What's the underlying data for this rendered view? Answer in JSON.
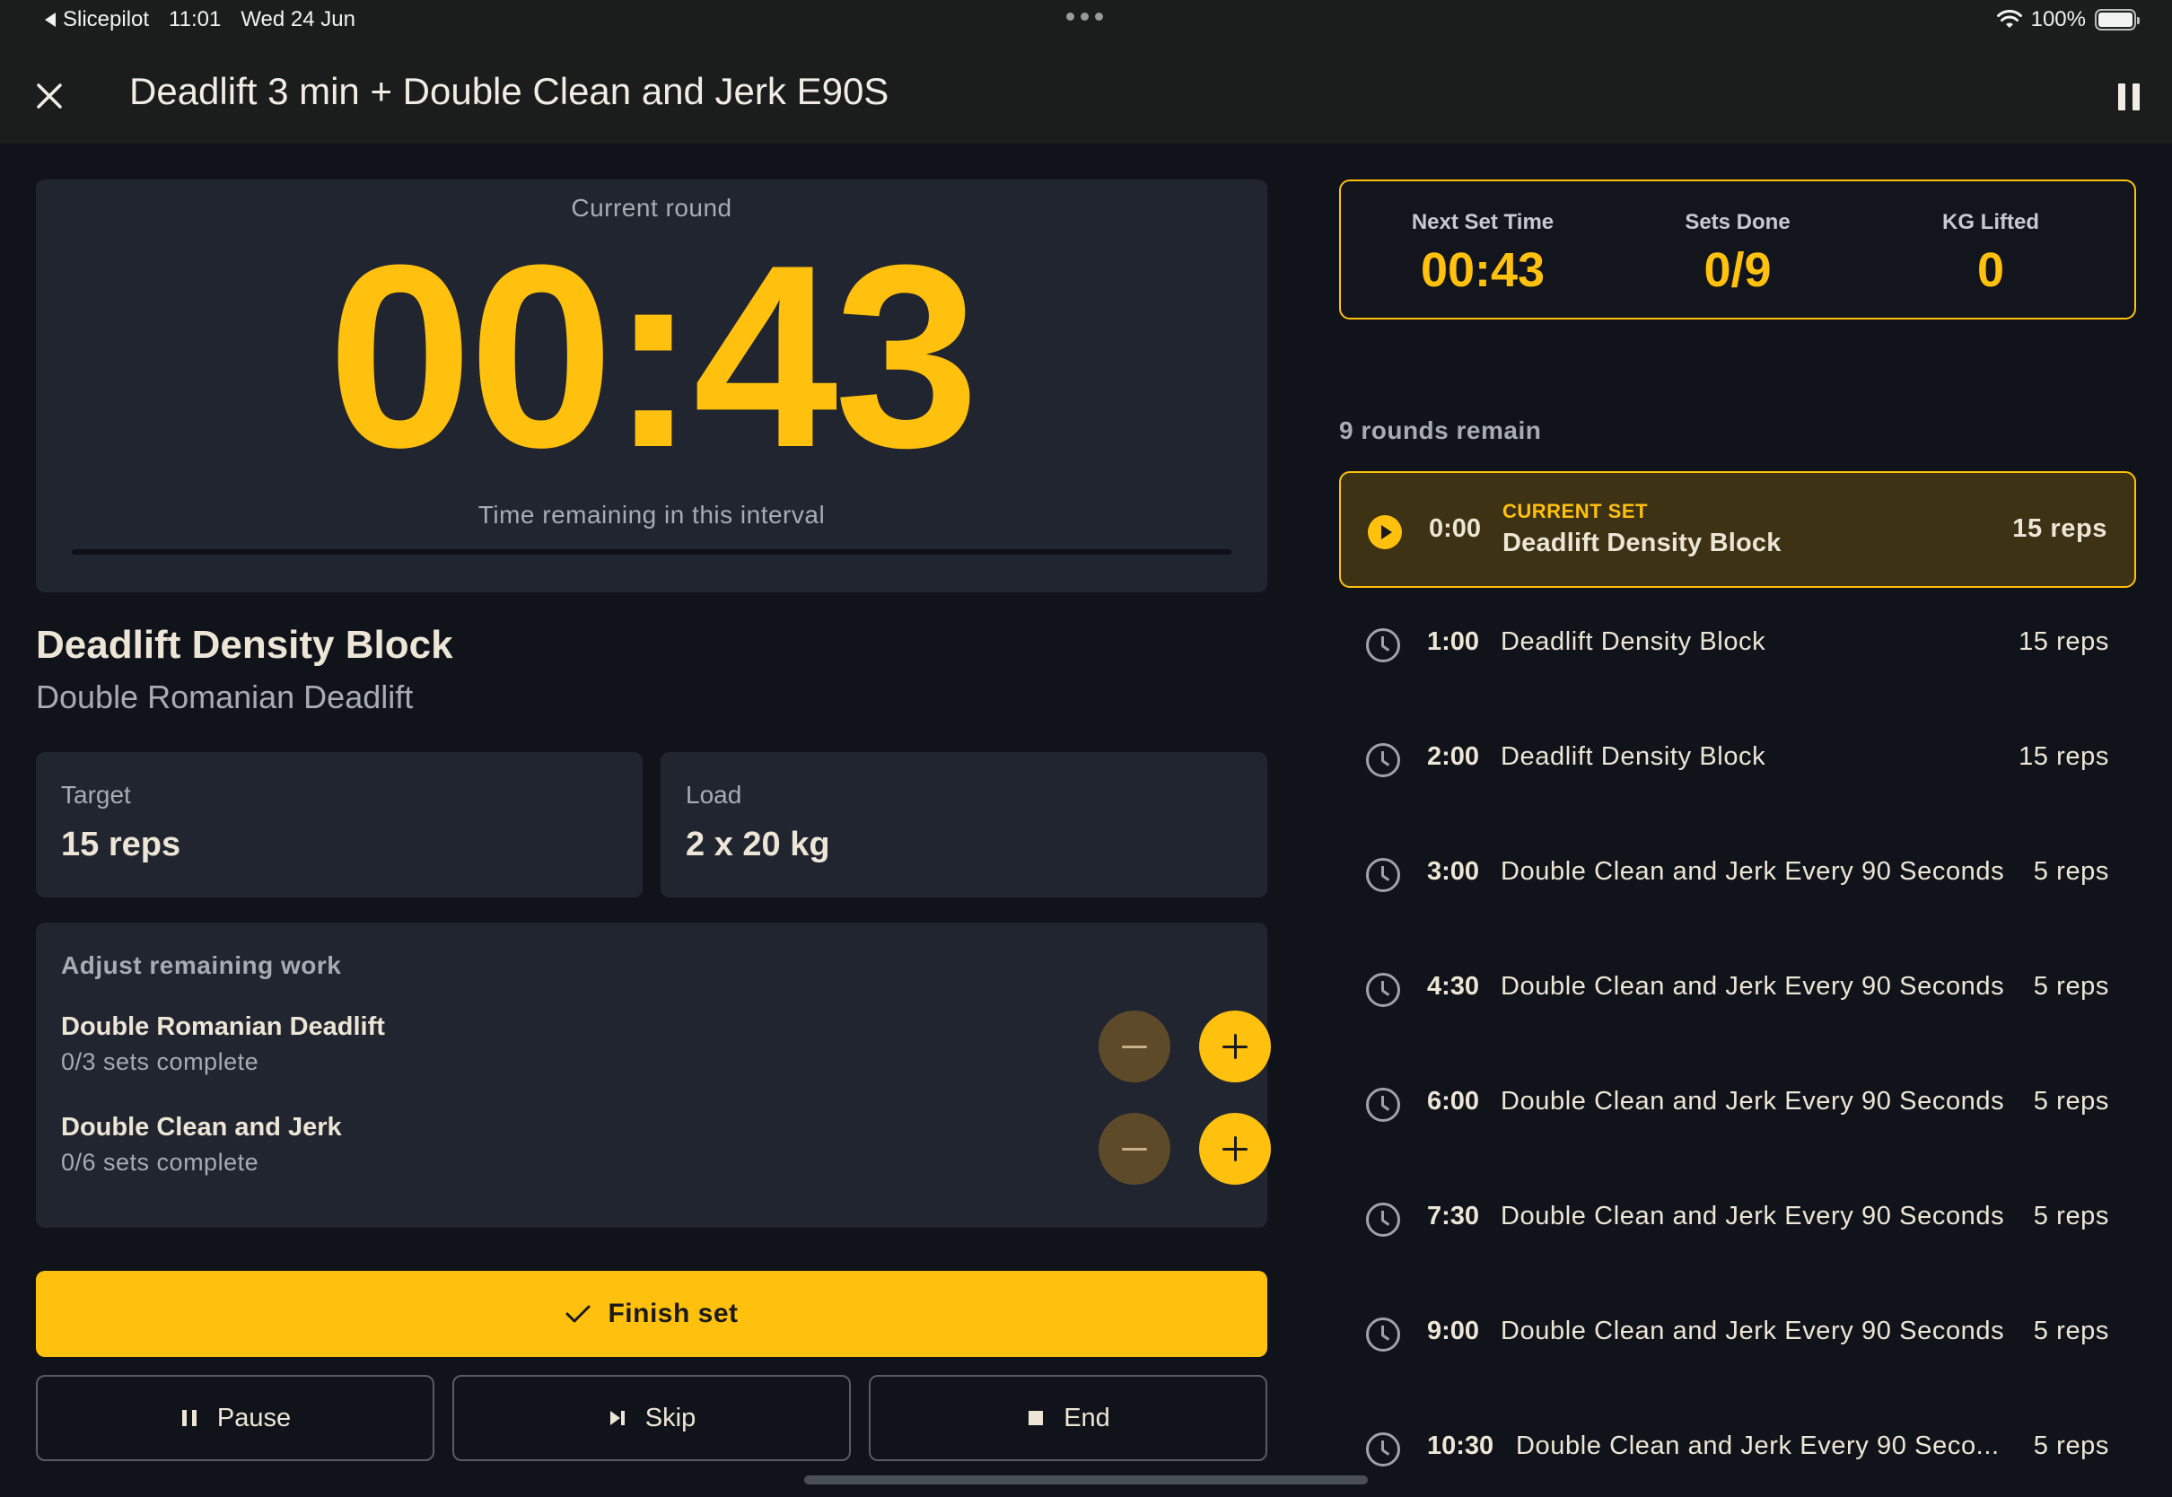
{
  "status_bar": {
    "back_app": "Slicepilot",
    "time": "11:01",
    "date": "Wed 24 Jun",
    "battery": "100%"
  },
  "header": {
    "title": "Deadlift 3 min + Double Clean and Jerk E90S",
    "close_icon": "close-icon",
    "pause_icon": "pause-icon"
  },
  "timer": {
    "label": "Current round",
    "time": "00:43",
    "subtitle": "Time remaining in this interval",
    "progress": 0.0
  },
  "exercise": {
    "title": "Deadlift Density Block",
    "subtitle": "Double Romanian Deadlift"
  },
  "stats": {
    "target": {
      "label": "Target",
      "value": "15 reps"
    },
    "load": {
      "label": "Load",
      "value": "2 x 20 kg"
    }
  },
  "adjust": {
    "title": "Adjust remaining work",
    "items": [
      {
        "name": "Double Romanian Deadlift",
        "progress": "0/3 sets complete"
      },
      {
        "name": "Double Clean and Jerk",
        "progress": "0/6 sets complete"
      }
    ]
  },
  "actions": {
    "finish": "Finish set",
    "pause": "Pause",
    "skip": "Skip",
    "end": "End"
  },
  "summary": {
    "next_set": {
      "label": "Next Set Time",
      "value": "00:43"
    },
    "sets_done": {
      "label": "Sets Done",
      "value": "0/9"
    },
    "kg_lifted": {
      "label": "KG Lifted",
      "value": "0"
    }
  },
  "rounds_remain": "9 rounds remain",
  "rounds": [
    {
      "time": "0:00",
      "kicker": "CURRENT SET",
      "name": "Deadlift Density Block",
      "reps": "15 reps",
      "current": true
    },
    {
      "time": "1:00",
      "name": "Deadlift Density Block",
      "reps": "15 reps"
    },
    {
      "time": "2:00",
      "name": "Deadlift Density Block",
      "reps": "15 reps"
    },
    {
      "time": "3:00",
      "name": "Double Clean and Jerk Every 90 Seconds",
      "reps": "5 reps"
    },
    {
      "time": "4:30",
      "name": "Double Clean and Jerk Every 90 Seconds",
      "reps": "5 reps"
    },
    {
      "time": "6:00",
      "name": "Double Clean and Jerk Every 90 Seconds",
      "reps": "5 reps"
    },
    {
      "time": "7:30",
      "name": "Double Clean and Jerk Every 90 Seconds",
      "reps": "5 reps"
    },
    {
      "time": "9:00",
      "name": "Double Clean and Jerk Every 90 Seconds",
      "reps": "5 reps"
    },
    {
      "time": "10:30",
      "name": "Double Clean and Jerk Every 90 Seco...",
      "reps": "5 reps"
    }
  ],
  "colors": {
    "accent": "#ffc10d",
    "background": "#10141a",
    "card": "#212530",
    "header": "#1b1c1c"
  }
}
